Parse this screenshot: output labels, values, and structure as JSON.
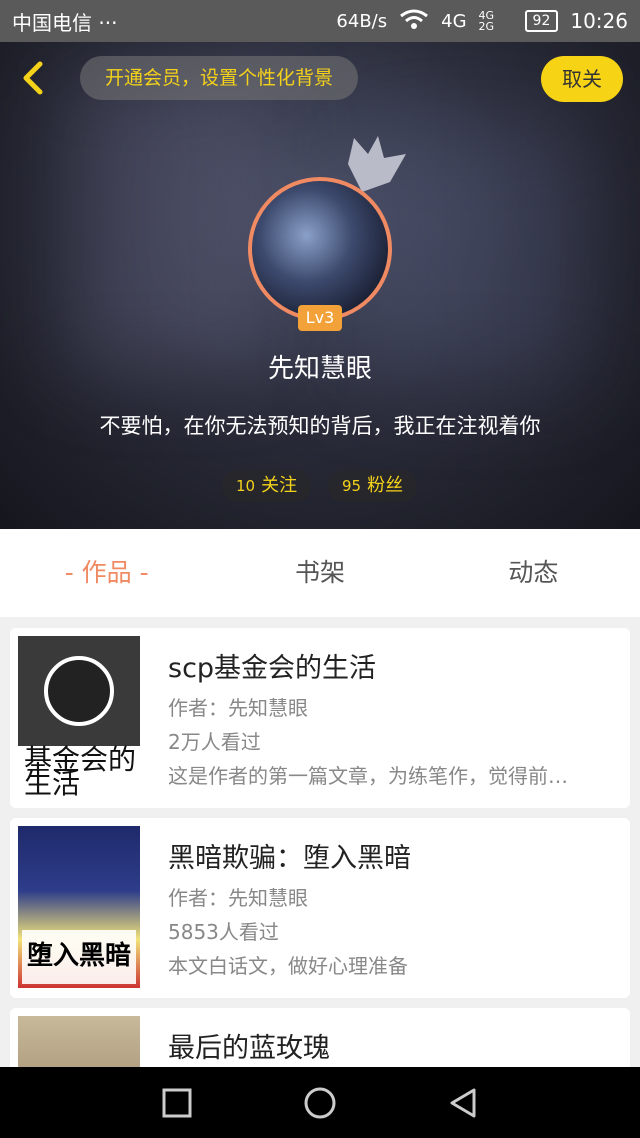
{
  "status_bar": {
    "carrier": "中国电信 ···",
    "speed": "64B/s",
    "network": "4G",
    "network_small": "4G 2G",
    "battery": "92",
    "time": "10:26"
  },
  "header": {
    "vip_text": "开通会员，设置个性化背景",
    "unfollow_label": "取关",
    "level": "Lv3",
    "username": "先知慧眼",
    "bio": "不要怕，在你无法预知的背后，我正在注视着你",
    "following_count": "10",
    "following_label": "关注",
    "fans_count": "95",
    "fans_label": "粉丝"
  },
  "tabs": [
    {
      "label": "- 作品 -",
      "active": true
    },
    {
      "label": "书架",
      "active": false
    },
    {
      "label": "动态",
      "active": false
    }
  ],
  "works": [
    {
      "title": "scp基金会的生活",
      "author": "作者：先知慧眼",
      "views": "2万人看过",
      "desc": "这是作者的第一篇文章，为练笔作，觉得前…",
      "cover_text": "基金会的生活"
    },
    {
      "title": "黑暗欺骗：堕入黑暗",
      "author": "作者：先知慧眼",
      "views": "5853人看过",
      "desc": "本文白话文，做好心理准备",
      "cover_text": "堕入黑暗"
    },
    {
      "title": "最后的蓝玫瑰",
      "author": "",
      "views": "",
      "desc": "",
      "cover_text": ""
    }
  ],
  "colors": {
    "accent_yellow": "#f7d316",
    "accent_orange": "#f08a62",
    "level_badge": "#f3a23a"
  },
  "icons": {
    "back": "chevron-left-icon",
    "crown": "crown-icon",
    "nav_recent": "square-icon",
    "nav_home": "circle-icon",
    "nav_back": "triangle-left-icon"
  }
}
